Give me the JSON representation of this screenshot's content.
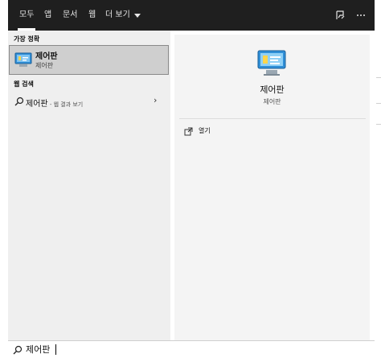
{
  "tabs": [
    {
      "label": "모두"
    },
    {
      "label": "앱"
    },
    {
      "label": "문서"
    },
    {
      "label": "웹"
    },
    {
      "label": "더 보기"
    }
  ],
  "icons": {
    "feedback": "feedback-icon",
    "more": "more-options-icon",
    "search": "search-icon",
    "control_panel": "control-panel-icon",
    "open": "open-icon",
    "chevron": "chevron-right-icon"
  },
  "left": {
    "best_match_header": "가장 정확",
    "best_match": {
      "title": "제어판",
      "subtitle": "제어판"
    },
    "web_header": "웹 검색",
    "web_item": {
      "query": "제어판",
      "suffix": " - 웹 결과 보기"
    }
  },
  "right": {
    "title": "제어판",
    "subtitle": "제어판",
    "open_label": "열기"
  },
  "search": {
    "value": "제어판"
  },
  "colors": {
    "topbar": "#1f1f1f",
    "panel": "#efefef",
    "selected": "#cfcfcf"
  }
}
